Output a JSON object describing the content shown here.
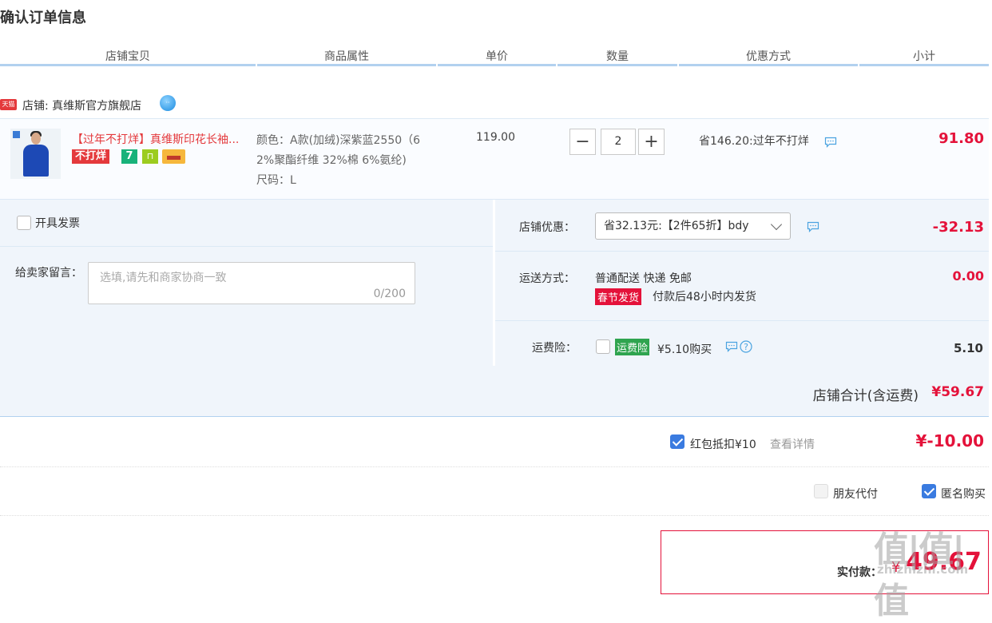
{
  "page": {
    "title": "确认订单信息"
  },
  "table_header": [
    "店铺宝贝",
    "商品属性",
    "单价",
    "数量",
    "优惠方式",
    "小计"
  ],
  "shop": {
    "logo_text": "天猫",
    "label": "店铺: 真维斯官方旗舰店",
    "chat_icon": "wangwang-icon"
  },
  "item": {
    "name": "【过年不打烊】真维斯印花长袖...",
    "badge_text": "不打烊",
    "badge_7": "7",
    "attr_line1": "颜色：A款(加绒)深紫蓝2550（6",
    "attr_line2": "2%聚酯纤维 32%棉 6%氨纶)",
    "attr_line3": "尺码：L",
    "price": "119.00",
    "quantity": "2",
    "qty_minus": "−",
    "qty_plus": "+",
    "promo": "省146.20:过年不打烊",
    "subtotal": "91.80"
  },
  "invoice": {
    "label": "开具发票"
  },
  "message": {
    "label": "给卖家留言：",
    "placeholder": "选填,请先和商家协商一致",
    "counter": "0/200"
  },
  "shop_discount": {
    "label": "店铺优惠：",
    "selected": "省32.13元:【2件65折】bdy",
    "value": "-32.13"
  },
  "shipping": {
    "label": "运送方式：",
    "method": "普通配送 快递 免邮",
    "tag": "春节发货",
    "note": "付款后48小时内发货",
    "value": "0.00"
  },
  "insurance": {
    "label": "运费险：",
    "tag": "运费险",
    "text": "¥5.10购买",
    "value": "5.10"
  },
  "shop_total": {
    "label": "店铺合计(含运费)",
    "value": "¥59.67"
  },
  "red_packet": {
    "label": "红包抵扣¥10",
    "link": "查看详情",
    "value": "¥-10.00"
  },
  "options": {
    "friend_pay": "朋友代付",
    "anonymous": "匿名购买"
  },
  "payment": {
    "label": "实付款：",
    "currency": "¥",
    "amount": "49.67"
  },
  "watermark": {
    "text": "值|值|值",
    "sub": "zhizhizhi.com"
  },
  "colors": {
    "accent_red": "#e4123a",
    "header_blue": "#b2d1ef",
    "panel_bg": "#f0f5fb",
    "checkbox_blue": "#3a7be0"
  }
}
